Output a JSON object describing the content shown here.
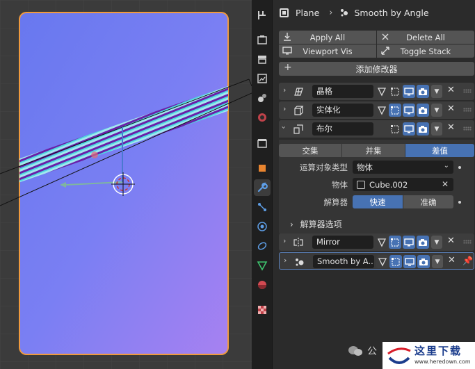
{
  "header": {
    "object_name": "Plane",
    "modifier_name": "Smooth by Angle"
  },
  "ops": {
    "apply_all": "Apply All",
    "delete_all": "Delete All",
    "viewport_vis": "Viewport Vis",
    "toggle_stack": "Toggle Stack"
  },
  "add_modifier": "添加修改器",
  "modifiers": [
    {
      "name": "晶格",
      "icon": "lattice-icon"
    },
    {
      "name": "实体化",
      "icon": "solidify-icon"
    },
    {
      "name": "布尔",
      "icon": "boolean-icon"
    },
    {
      "name": "Mirror",
      "icon": "mirror-icon"
    },
    {
      "name": "Smooth by A...",
      "icon": "smooth-by-angle-icon"
    }
  ],
  "boolean": {
    "ops": [
      "交集",
      "并集",
      "差值"
    ],
    "selected_op": "差值",
    "operand_type_label": "运算对象类型",
    "operand_type_value": "物体",
    "object_label": "物体",
    "object_value": "Cube.002",
    "solver_label": "解算器",
    "solver_options": [
      "快速",
      "准确"
    ],
    "selected_solver": "快速",
    "solver_options_panel": "解算器选项"
  },
  "watermark": {
    "left_text": "公",
    "brand": "这里下载",
    "url": "www.heredown.com"
  },
  "colors": {
    "accent": "#4772b3",
    "panel": "#2b2b2b",
    "plane_top": "#6a78f0",
    "plane_bottom": "#a27ff2",
    "outline": "#f09a3e"
  }
}
